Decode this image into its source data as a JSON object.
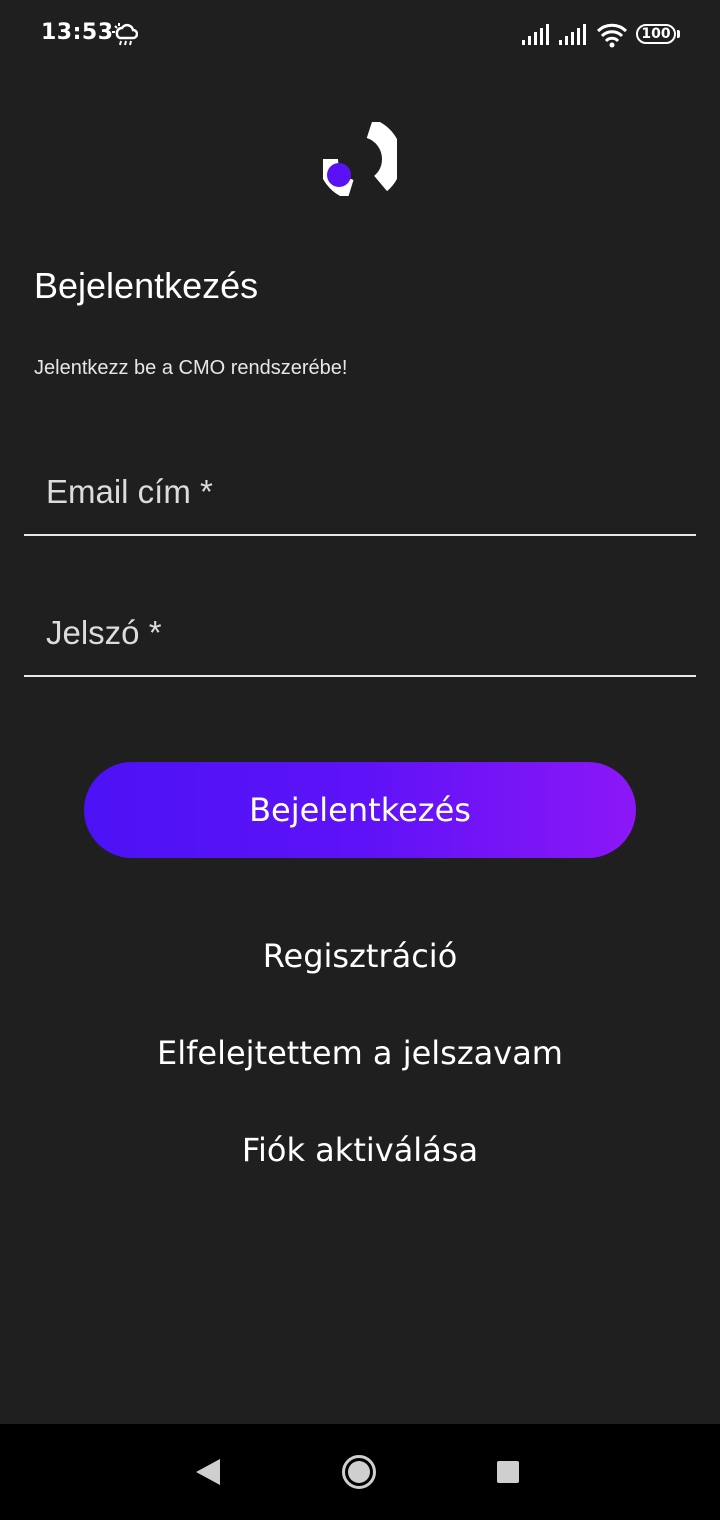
{
  "status_bar": {
    "time": "13:53",
    "battery_level": "100",
    "icons": [
      "weather-icon",
      "signal-icon",
      "signal-icon",
      "wifi-icon",
      "battery-icon"
    ]
  },
  "logo": {
    "icon": "app-logo-icon",
    "accent_color": "#5a12f5"
  },
  "page": {
    "title": "Bejelentkezés",
    "subtitle": "Jelentkezz be a CMO rendszerébe!"
  },
  "form": {
    "email": {
      "placeholder": "Email cím *",
      "value": ""
    },
    "password": {
      "placeholder": "Jelszó *",
      "value": ""
    },
    "submit_label": "Bejelentkezés"
  },
  "links": {
    "register": "Regisztráció",
    "forgot_password": "Elfelejtettem a jelszavam",
    "activate_account": "Fiók aktiválása"
  },
  "nav_bar": {
    "icons": [
      "back-icon",
      "home-icon",
      "recents-icon"
    ]
  },
  "colors": {
    "background": "#1f1f1f",
    "button_gradient_start": "#4c12f5",
    "button_gradient_end": "#8c17f7",
    "text": "#ffffff"
  }
}
